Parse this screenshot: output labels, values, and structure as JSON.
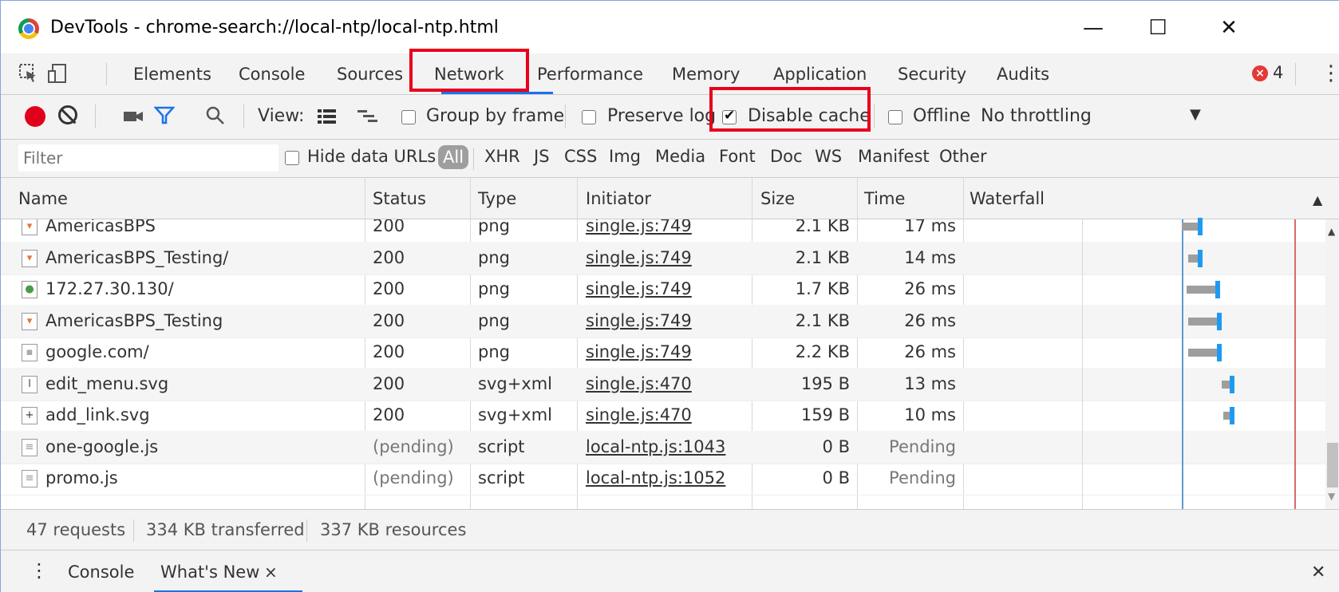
{
  "window": {
    "title": "DevTools - chrome-search://local-ntp/local-ntp.html",
    "minimize": "—",
    "maximize": "☐",
    "close": "✕"
  },
  "tabs": [
    "Elements",
    "Console",
    "Sources",
    "Network",
    "Performance",
    "Memory",
    "Application",
    "Security",
    "Audits"
  ],
  "active_tab": "Network",
  "errors": {
    "count": "4"
  },
  "toolbar": {
    "view_label": "View:",
    "group_by_frame": "Group by frame",
    "preserve_log": "Preserve log",
    "disable_cache": "Disable cache",
    "offline": "Offline",
    "throttling": "No throttling"
  },
  "filter": {
    "placeholder": "Filter",
    "hide_data_urls": "Hide data URLs",
    "types": [
      "All",
      "XHR",
      "JS",
      "CSS",
      "Img",
      "Media",
      "Font",
      "Doc",
      "WS",
      "Manifest",
      "Other"
    ]
  },
  "columns": [
    "Name",
    "Status",
    "Type",
    "Initiator",
    "Size",
    "Time",
    "Waterfall"
  ],
  "rows": [
    {
      "name": "AmericasBPS",
      "status": "200",
      "type": "png",
      "initiator": "single.js:749",
      "size": "2.1 KB",
      "time": "17 ms"
    },
    {
      "name": "AmericasBPS_Testing/",
      "status": "200",
      "type": "png",
      "initiator": "single.js:749",
      "size": "2.1 KB",
      "time": "14 ms"
    },
    {
      "name": "172.27.30.130/",
      "status": "200",
      "type": "png",
      "initiator": "single.js:749",
      "size": "1.7 KB",
      "time": "26 ms"
    },
    {
      "name": "AmericasBPS_Testing",
      "status": "200",
      "type": "png",
      "initiator": "single.js:749",
      "size": "2.1 KB",
      "time": "26 ms"
    },
    {
      "name": "google.com/",
      "status": "200",
      "type": "png",
      "initiator": "single.js:749",
      "size": "2.2 KB",
      "time": "26 ms"
    },
    {
      "name": "edit_menu.svg",
      "status": "200",
      "type": "svg+xml",
      "initiator": "single.js:470",
      "size": "195 B",
      "time": "13 ms"
    },
    {
      "name": "add_link.svg",
      "status": "200",
      "type": "svg+xml",
      "initiator": "single.js:470",
      "size": "159 B",
      "time": "10 ms"
    },
    {
      "name": "one-google.js",
      "status": "(pending)",
      "type": "script",
      "initiator": "local-ntp.js:1043",
      "size": "0 B",
      "time": "Pending"
    },
    {
      "name": "promo.js",
      "status": "(pending)",
      "type": "script",
      "initiator": "local-ntp.js:1052",
      "size": "0 B",
      "time": "Pending"
    }
  ],
  "status": {
    "requests": "47 requests",
    "transferred": "334 KB transferred",
    "resources": "337 KB resources"
  },
  "drawer": {
    "console": "Console",
    "whats_new": "What's New",
    "close_tab": "×",
    "close": "✕"
  },
  "icons": {
    "record": "record-icon",
    "clear": "clear-icon",
    "camera": "camera-icon",
    "filter": "filter-icon",
    "search": "search-icon"
  },
  "colors": {
    "highlight": "#e8001c",
    "accent": "#1a73e8",
    "record": "#e0001b"
  }
}
